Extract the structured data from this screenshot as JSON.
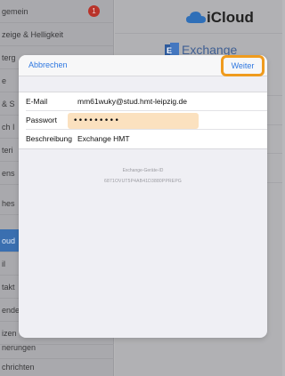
{
  "sidebar": {
    "items": [
      {
        "label": "gemein",
        "badge": "1"
      },
      {
        "label": "zeige & Helligkeit"
      },
      {
        "label": "terg"
      },
      {
        "label": "e"
      },
      {
        "label": "& S"
      },
      {
        "label": "ch I"
      },
      {
        "label": "teri"
      },
      {
        "label": "ens"
      },
      {
        "label": "hes"
      },
      {
        "label": "oud"
      },
      {
        "label": "il"
      },
      {
        "label": "takt"
      },
      {
        "label": "ende"
      },
      {
        "label": "izen"
      },
      {
        "label": "nerungen"
      },
      {
        "label": "chrichten"
      }
    ]
  },
  "detail": {
    "icloud_label": "iCloud",
    "exchange_label": "Exchange"
  },
  "modal": {
    "cancel_label": "Abbrechen",
    "next_label": "Weiter",
    "fields": {
      "email_label": "E-Mail",
      "email_value": "mm61wuky@stud.hmt-leipzig.de",
      "password_label": "Passwort",
      "password_value": "•••••••••",
      "description_label": "Beschreibung",
      "description_value": "Exchange HMT"
    },
    "device_id_label": "Exchange-Geräte-ID",
    "device_id_value": "6871OVUT5P4AB41D3880PPREPG"
  },
  "colors": {
    "accent": "#2f78e0",
    "highlight": "#ef9b1e",
    "password_fill": "#fbe1bf"
  }
}
